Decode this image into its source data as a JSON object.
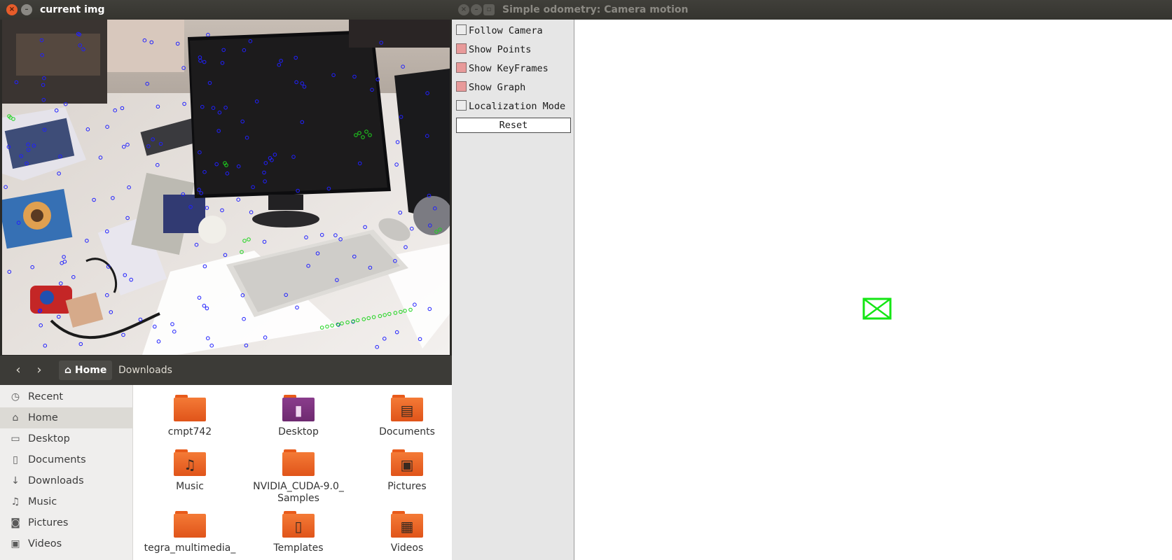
{
  "file_manager": {
    "nav": {
      "back_icon": "‹",
      "forward_icon": "›"
    },
    "breadcrumb": [
      {
        "label": "Home",
        "icon": "home-icon",
        "active": true
      },
      {
        "label": "Downloads",
        "active": false
      }
    ],
    "sidebar": [
      {
        "label": "Recent",
        "icon": "clock-icon",
        "glyph": "◷",
        "active": false
      },
      {
        "label": "Home",
        "icon": "home-icon",
        "glyph": "⌂",
        "active": true
      },
      {
        "label": "Desktop",
        "icon": "desktop-icon",
        "glyph": "▭",
        "active": false
      },
      {
        "label": "Documents",
        "icon": "document-icon",
        "glyph": "▯",
        "active": false
      },
      {
        "label": "Downloads",
        "icon": "download-icon",
        "glyph": "↓",
        "active": false
      },
      {
        "label": "Music",
        "icon": "music-icon",
        "glyph": "♫",
        "active": false
      },
      {
        "label": "Pictures",
        "icon": "camera-icon",
        "glyph": "◙",
        "active": false
      },
      {
        "label": "Videos",
        "icon": "video-icon",
        "glyph": "▣",
        "active": false
      }
    ],
    "files": [
      {
        "name": "cmpt742",
        "icon": "folder-icon",
        "glyph": ""
      },
      {
        "name": "Desktop",
        "icon": "desktop-folder-icon",
        "glyph": "▮"
      },
      {
        "name": "Documents",
        "icon": "documents-folder-icon",
        "glyph": "▤"
      },
      {
        "name": "Music",
        "icon": "music-folder-icon",
        "glyph": "♫"
      },
      {
        "name": "NVIDIA_CUDA-9.0_\nSamples",
        "icon": "folder-icon",
        "glyph": ""
      },
      {
        "name": "Pictures",
        "icon": "pictures-folder-icon",
        "glyph": "▣"
      },
      {
        "name": "tegra_multimedia_",
        "icon": "folder-icon",
        "glyph": ""
      },
      {
        "name": "Templates",
        "icon": "templates-folder-icon",
        "glyph": "▯"
      },
      {
        "name": "Videos",
        "icon": "videos-folder-icon",
        "glyph": "▦"
      }
    ]
  },
  "image_window": {
    "title": "current img",
    "buttons": {
      "close_glyph": "×",
      "minimize_glyph": "–"
    },
    "feature_colors": {
      "tracked": "#2020ff",
      "new": "#1ed41e"
    }
  },
  "viewer_window": {
    "title": "Simple odometry: Camera motion",
    "controls": [
      {
        "label": "Follow Camera",
        "checked": false
      },
      {
        "label": "Show Points",
        "checked": true
      },
      {
        "label": "Show KeyFrames",
        "checked": true
      },
      {
        "label": "Show Graph",
        "checked": true
      },
      {
        "label": "Localization Mode",
        "checked": false
      }
    ],
    "reset_label": "Reset",
    "camera_color": "#14e614"
  },
  "colors": {
    "titlebar": "#3c3b37",
    "title_text": "#dfdbd2",
    "close_button": "#df4a16",
    "checkbox_on": "#e89a9a"
  }
}
